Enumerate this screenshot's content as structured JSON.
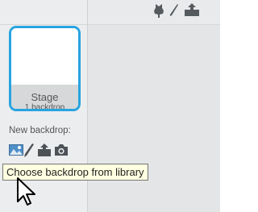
{
  "stage": {
    "name": "Stage",
    "backdrop_count": "1 backdrop"
  },
  "new_backdrop": {
    "label": "New backdrop:",
    "tools": [
      "image-icon",
      "paintbrush-icon",
      "upload-icon",
      "camera-icon"
    ]
  },
  "tooltip": {
    "text": "Choose backdrop from library"
  },
  "colors": {
    "selection": "#28a4e0",
    "tooltip_bg": "#ffffe1",
    "icon": "#4d5257"
  }
}
